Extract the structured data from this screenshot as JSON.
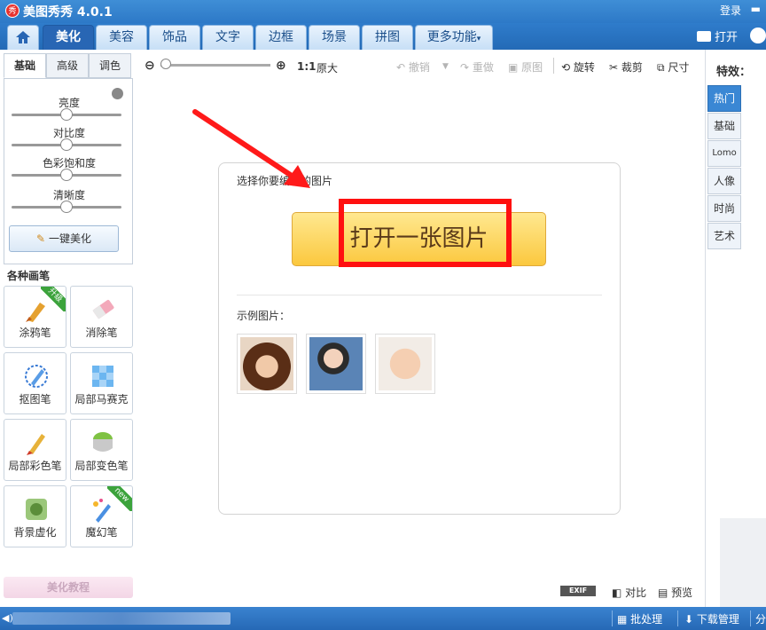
{
  "app": {
    "title": "美图秀秀 4.0.1",
    "logo_char": "秀",
    "login": "登录"
  },
  "tabs": [
    "美化",
    "美容",
    "饰品",
    "文字",
    "边框",
    "场景",
    "拼图",
    "更多功能"
  ],
  "open_label": "打开",
  "left": {
    "subtabs": [
      "基础",
      "高级",
      "调色"
    ],
    "sliders": [
      "亮度",
      "对比度",
      "色彩饱和度",
      "清晰度"
    ],
    "one_click": "一键美化",
    "brush_title": "各种画笔",
    "tools": [
      {
        "label": "涂鸦笔",
        "badge": "升级"
      },
      {
        "label": "消除笔",
        "badge": ""
      },
      {
        "label": "抠图笔",
        "badge": ""
      },
      {
        "label": "局部马赛克",
        "badge": ""
      },
      {
        "label": "局部彩色笔",
        "badge": ""
      },
      {
        "label": "局部变色笔",
        "badge": ""
      },
      {
        "label": "背景虚化",
        "badge": ""
      },
      {
        "label": "魔幻笔",
        "badge": "new"
      }
    ],
    "tutorial": "美化教程"
  },
  "toolbar": {
    "ratio": "1:1",
    "original_size": "原大",
    "undo": "撤销",
    "redo": "重做",
    "original": "原图",
    "rotate": "旋转",
    "crop": "裁剪",
    "size": "尺寸"
  },
  "welcome": {
    "choose_label": "选择你要编辑的图片",
    "open_button": "打开一张图片",
    "samples_label": "示例图片："
  },
  "effects": {
    "title": "特效：",
    "tabs": [
      "热门",
      "基础",
      "Lomo",
      "人像",
      "时尚",
      "艺术"
    ]
  },
  "bottom": {
    "exif": "EXIF",
    "compare": "对比",
    "preview": "预览"
  },
  "status": {
    "batch": "批处理",
    "download": "下载管理",
    "share": "分"
  },
  "colors": {
    "accent": "#2866b4",
    "highlight": "#ff1010",
    "button": "#fbc83e"
  }
}
